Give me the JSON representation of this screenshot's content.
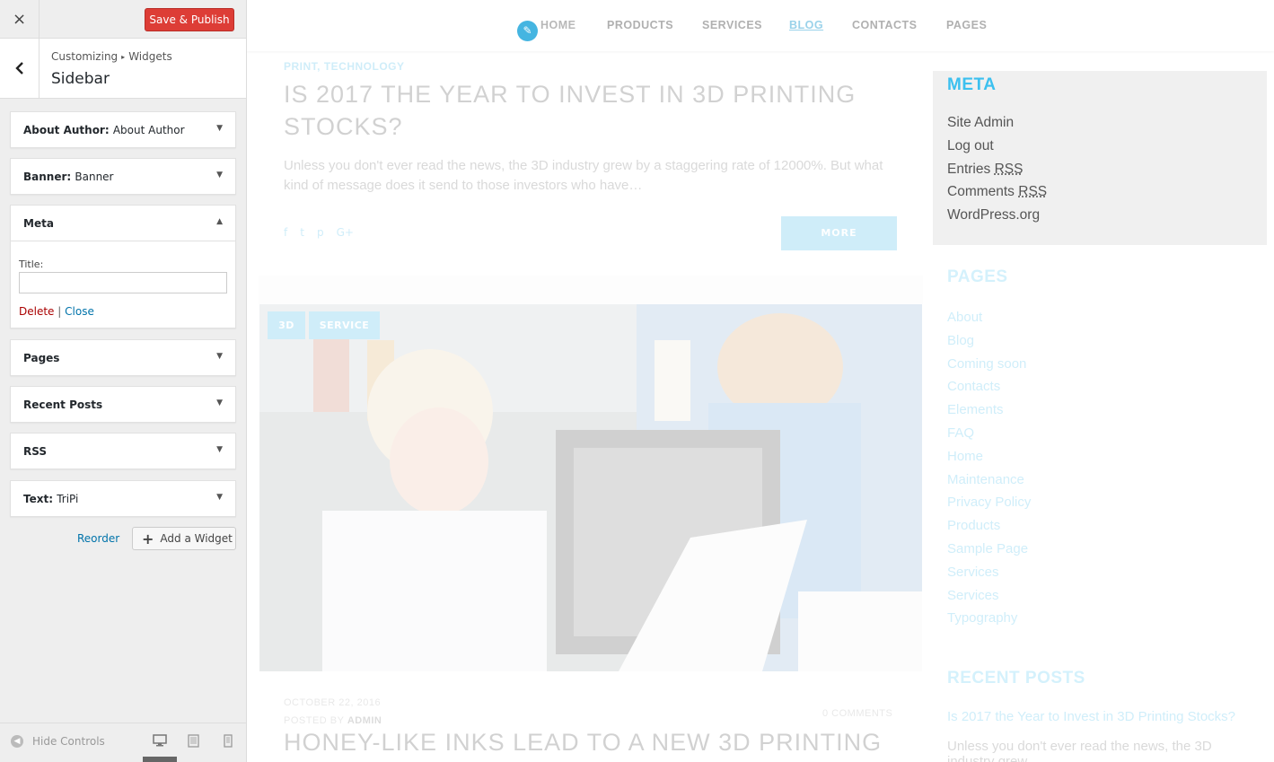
{
  "customizer": {
    "close_icon": "×",
    "save_label": "Save & Publish",
    "breadcrumb": {
      "root": "Customizing",
      "separator": "▸",
      "child": "Widgets"
    },
    "section_title": "Sidebar",
    "widgets": [
      {
        "type": "About Author:",
        "title": "About Author"
      },
      {
        "type": "Banner:",
        "title": "Banner"
      },
      {
        "type": "Meta",
        "title": ""
      },
      {
        "type": "Pages",
        "title": ""
      },
      {
        "type": "Recent Posts",
        "title": ""
      },
      {
        "type": "RSS",
        "title": ""
      },
      {
        "type": "Text:",
        "title": "TriPi"
      }
    ],
    "meta_form": {
      "title_label": "Title:",
      "title_value": "",
      "delete_label": "Delete",
      "separator": "|",
      "close_label": "Close"
    },
    "reorder_label": "Reorder",
    "add_widget_label": "Add a Widget",
    "hide_controls_label": "Hide Controls",
    "devices": [
      "desktop-icon",
      "tablet-icon",
      "mobile-icon"
    ],
    "save_color": "#dd3d36"
  },
  "preview": {
    "nav": [
      "HOME",
      "PRODUCTS",
      "SERVICES",
      "BLOG",
      "CONTACTS",
      "PAGES"
    ],
    "active_nav": "BLOG",
    "post1": {
      "categories": "PRINT, TECHNOLOGY",
      "title": "IS 2017 THE YEAR TO INVEST IN 3D PRINTING STOCKS?",
      "excerpt": "Unless you don't ever read the news, the 3D industry grew by a staggering rate of 12000%. But what kind of message does it send to those investors who have…",
      "more_label": "MORE"
    },
    "post2": {
      "tags": [
        "3D",
        "SERVICE"
      ],
      "date": "OCTOBER 22, 2016",
      "posted_by_prefix": "POSTED BY",
      "author": "ADMIN",
      "comments": "0 COMMENTS",
      "title": "HONEY-LIKE INKS LEAD TO A NEW 3D PRINTING"
    },
    "sidebar": {
      "meta_title": "META",
      "meta_links": {
        "site_admin": "Site Admin",
        "log_out": "Log out",
        "entries": "Entries",
        "comments": "Comments",
        "rss": "RSS",
        "wordpress": "WordPress.org"
      },
      "pages_title": "PAGES",
      "pages": [
        "About",
        "Blog",
        "Coming soon",
        "Contacts",
        "Elements",
        "FAQ",
        "Home",
        "Maintenance",
        "Privacy Policy",
        "Products",
        "Sample Page",
        "Services",
        "Services",
        "Typography"
      ],
      "recent_title": "RECENT POSTS",
      "recent_link": "Is 2017 the Year to Invest in 3D Printing Stocks?",
      "recent_excerpt": "Unless you don't ever read the news, the 3D industry grew"
    },
    "accent_color": "#28b0e6"
  }
}
